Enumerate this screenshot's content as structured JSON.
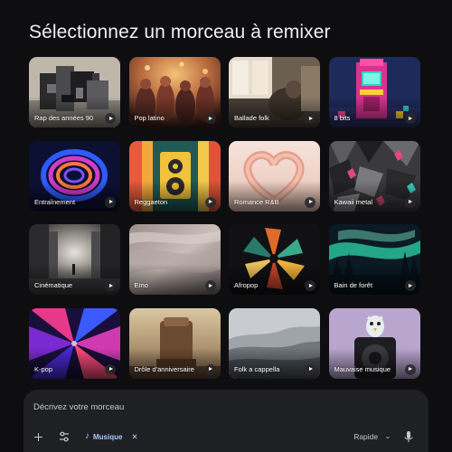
{
  "page": {
    "title": "Sélectionnez un morceau à remixer"
  },
  "tiles": [
    {
      "label": "Rap des années 90",
      "icon": "play-icon"
    },
    {
      "label": "Pop latino",
      "icon": "play-icon"
    },
    {
      "label": "Ballade folk",
      "icon": "play-icon"
    },
    {
      "label": "8 bits",
      "icon": "play-icon"
    },
    {
      "label": "Entraînement",
      "icon": "play-icon"
    },
    {
      "label": "Reggaeton",
      "icon": "play-icon"
    },
    {
      "label": "Romance R&B",
      "icon": "play-icon"
    },
    {
      "label": "Kawaii metal",
      "icon": "play-icon"
    },
    {
      "label": "Cinématique",
      "icon": "play-icon"
    },
    {
      "label": "Emo",
      "icon": "play-icon"
    },
    {
      "label": "Afropop",
      "icon": "play-icon"
    },
    {
      "label": "Bain de forêt",
      "icon": "play-icon"
    },
    {
      "label": "K-pop",
      "icon": "play-icon"
    },
    {
      "label": "Drôle d'anniversaire",
      "icon": "play-icon"
    },
    {
      "label": "Folk a cappella",
      "icon": "play-icon"
    },
    {
      "label": "Mauvaise musique",
      "icon": "play-icon"
    }
  ],
  "composer": {
    "placeholder": "Décrivez votre morceau",
    "chip": {
      "label": "Musique",
      "icon": "music-note-icon",
      "close_icon": "close-icon"
    },
    "mode": {
      "label": "Rapide",
      "icon": "chevron-down-icon"
    },
    "icons": [
      "plus-icon",
      "tune-icon",
      "mic-icon"
    ]
  },
  "colors": {
    "background": "#0e0e10",
    "composer": "#1f2023",
    "accent": "#a8c7fa"
  }
}
